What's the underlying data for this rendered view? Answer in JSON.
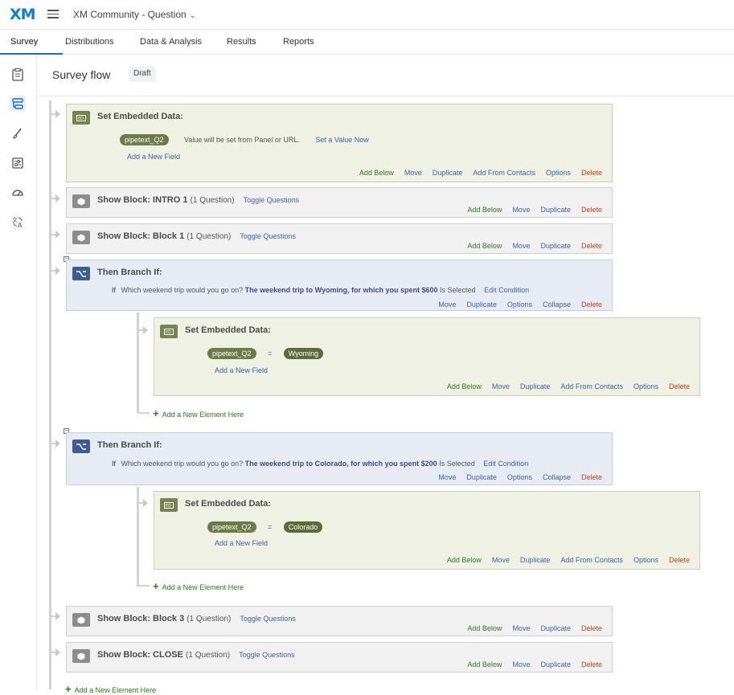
{
  "app": {
    "logo": "XM",
    "project_title": "XM Community - Question"
  },
  "tabs": [
    "Survey",
    "Distributions",
    "Data & Analysis",
    "Results",
    "Reports"
  ],
  "page": {
    "title": "Survey flow",
    "status_badge": "Draft"
  },
  "sidebar_icons": [
    "survey-icon",
    "flow-icon",
    "look-and-feel-icon",
    "options-icon",
    "tools-icon",
    "translate-icon"
  ],
  "colors": {
    "accent": "#1d6fc4",
    "embed_bg": "#eef1e3",
    "block_bg": "#f1f1f1",
    "branch_bg": "#e7ecf4",
    "add_green": "#2d7a1f",
    "delete_red": "#c8431a"
  },
  "flow": {
    "embed1": {
      "title": "Set Embedded Data:",
      "field": "pipetext_Q2",
      "hint": "Value will be set from Panel or URL.",
      "set_now": "Set a Value Now",
      "add_field": "Add a New Field",
      "actions": [
        "Add Below",
        "Move",
        "Duplicate",
        "Add From Contacts",
        "Options",
        "Delete"
      ]
    },
    "block_intro": {
      "title": "Show Block: INTRO 1",
      "count": "(1 Question)",
      "toggle": "Toggle Questions",
      "actions": [
        "Add Below",
        "Move",
        "Duplicate",
        "Delete"
      ]
    },
    "block1": {
      "title": "Show Block: Block 1",
      "count": "(1 Question)",
      "toggle": "Toggle Questions",
      "actions": [
        "Add Below",
        "Move",
        "Duplicate",
        "Delete"
      ]
    },
    "branch1": {
      "title": "Then Branch If:",
      "if": "If",
      "question": "Which weekend trip would you go on?",
      "choice": "The weekend trip to Wyoming, for which you spent $600",
      "operator": "Is Selected",
      "edit": "Edit Condition",
      "actions": [
        "Move",
        "Duplicate",
        "Options",
        "Collapse",
        "Delete"
      ],
      "embed": {
        "title": "Set Embedded Data:",
        "field": "pipetext_Q2",
        "eq": "=",
        "value": "Wyoming",
        "add_field": "Add a New Field",
        "actions": [
          "Add Below",
          "Move",
          "Duplicate",
          "Add From Contacts",
          "Options",
          "Delete"
        ]
      },
      "add_element": "Add a New Element Here"
    },
    "branch2": {
      "title": "Then Branch If:",
      "if": "If",
      "question": "Which weekend trip would you go on?",
      "choice": "The weekend trip to Colorado, for which you spent $200",
      "operator": "Is Selected",
      "edit": "Edit Condition",
      "actions": [
        "Move",
        "Duplicate",
        "Options",
        "Collapse",
        "Delete"
      ],
      "embed": {
        "title": "Set Embedded Data:",
        "field": "pipetext_Q2",
        "eq": "=",
        "value": "Colorado",
        "add_field": "Add a New Field",
        "actions": [
          "Add Below",
          "Move",
          "Duplicate",
          "Add From Contacts",
          "Options",
          "Delete"
        ]
      },
      "add_element": "Add a New Element Here"
    },
    "block3": {
      "title": "Show Block: Block 3",
      "count": "(1 Question)",
      "toggle": "Toggle Questions",
      "actions": [
        "Add Below",
        "Move",
        "Duplicate",
        "Delete"
      ]
    },
    "block_close": {
      "title": "Show Block: CLOSE",
      "count": "(1 Question)",
      "toggle": "Toggle Questions",
      "actions": [
        "Add Below",
        "Move",
        "Duplicate",
        "Delete"
      ]
    },
    "add_element_bottom": "Add a New Element Here"
  }
}
